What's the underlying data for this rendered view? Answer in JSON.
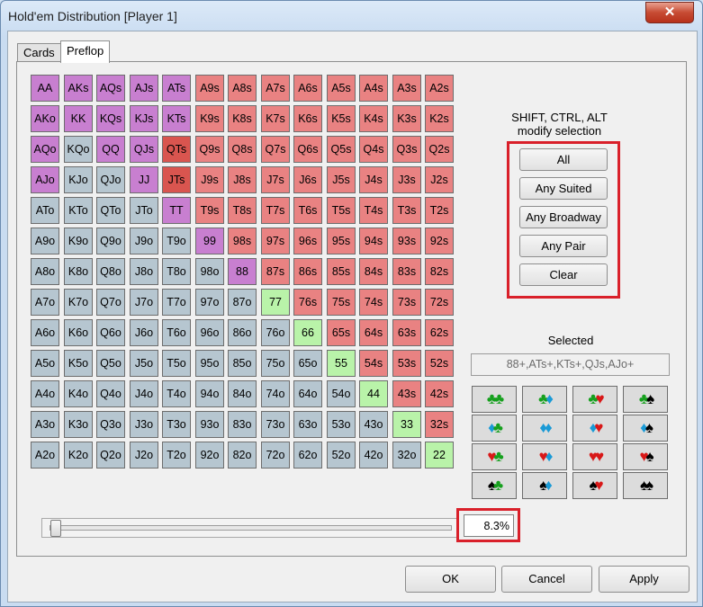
{
  "window": {
    "title": "Hold'em Distribution [Player 1]",
    "close_label": "✕"
  },
  "tabs": [
    {
      "label": "Cards"
    },
    {
      "label": "Preflop"
    }
  ],
  "grid": {
    "rows": [
      [
        "AA",
        "AKs",
        "AQs",
        "AJs",
        "ATs",
        "A9s",
        "A8s",
        "A7s",
        "A6s",
        "A5s",
        "A4s",
        "A3s",
        "A2s"
      ],
      [
        "AKo",
        "KK",
        "KQs",
        "KJs",
        "KTs",
        "K9s",
        "K8s",
        "K7s",
        "K6s",
        "K5s",
        "K4s",
        "K3s",
        "K2s"
      ],
      [
        "AQo",
        "KQo",
        "QQ",
        "QJs",
        "QTs",
        "Q9s",
        "Q8s",
        "Q7s",
        "Q6s",
        "Q5s",
        "Q4s",
        "Q3s",
        "Q2s"
      ],
      [
        "AJo",
        "KJo",
        "QJo",
        "JJ",
        "JTs",
        "J9s",
        "J8s",
        "J7s",
        "J6s",
        "J5s",
        "J4s",
        "J3s",
        "J2s"
      ],
      [
        "ATo",
        "KTo",
        "QTo",
        "JTo",
        "TT",
        "T9s",
        "T8s",
        "T7s",
        "T6s",
        "T5s",
        "T4s",
        "T3s",
        "T2s"
      ],
      [
        "A9o",
        "K9o",
        "Q9o",
        "J9o",
        "T9o",
        "99",
        "98s",
        "97s",
        "96s",
        "95s",
        "94s",
        "93s",
        "92s"
      ],
      [
        "A8o",
        "K8o",
        "Q8o",
        "J8o",
        "T8o",
        "98o",
        "88",
        "87s",
        "86s",
        "85s",
        "84s",
        "83s",
        "82s"
      ],
      [
        "A7o",
        "K7o",
        "Q7o",
        "J7o",
        "T7o",
        "97o",
        "87o",
        "77",
        "76s",
        "75s",
        "74s",
        "73s",
        "72s"
      ],
      [
        "A6o",
        "K6o",
        "Q6o",
        "J6o",
        "T6o",
        "96o",
        "86o",
        "76o",
        "66",
        "65s",
        "64s",
        "63s",
        "62s"
      ],
      [
        "A5o",
        "K5o",
        "Q5o",
        "J5o",
        "T5o",
        "95o",
        "85o",
        "75o",
        "65o",
        "55",
        "54s",
        "53s",
        "52s"
      ],
      [
        "A4o",
        "K4o",
        "Q4o",
        "J4o",
        "T4o",
        "94o",
        "84o",
        "74o",
        "64o",
        "54o",
        "44",
        "43s",
        "42s"
      ],
      [
        "A3o",
        "K3o",
        "Q3o",
        "J3o",
        "T3o",
        "93o",
        "83o",
        "73o",
        "63o",
        "53o",
        "43o",
        "33",
        "32s"
      ],
      [
        "A2o",
        "K2o",
        "Q2o",
        "J2o",
        "T2o",
        "92o",
        "82o",
        "72o",
        "62o",
        "52o",
        "42o",
        "32o",
        "22"
      ]
    ],
    "colors": {
      "selected": "#c87fd0",
      "suited": "#e98282",
      "offsuit": "#b6c6d0",
      "pair": "#b9f3a9",
      "highlight": "#d9554f"
    },
    "highlighted": [
      "QTs",
      "JTs"
    ]
  },
  "modify": {
    "hint": "SHIFT, CTRL, ALT\nmodify selection",
    "buttons": [
      "All",
      "Any Suited",
      "Any Broadway",
      "Any Pair",
      "Clear"
    ]
  },
  "selected": {
    "label": "Selected",
    "value": "88+,ATs+,KTs+,QJs,AJo+"
  },
  "suits": [
    [
      "♣♣",
      "♣♦",
      "♣♥",
      "♣♠"
    ],
    [
      "♦♣",
      "♦♦",
      "♦♥",
      "♦♠"
    ],
    [
      "♥♣",
      "♥♦",
      "♥♥",
      "♥♠"
    ],
    [
      "♠♣",
      "♠♦",
      "♠♥",
      "♠♠"
    ]
  ],
  "range": {
    "percent_label": "8.3%",
    "percent_value": 8.3
  },
  "footer": {
    "ok": "OK",
    "cancel": "Cancel",
    "apply": "Apply"
  }
}
